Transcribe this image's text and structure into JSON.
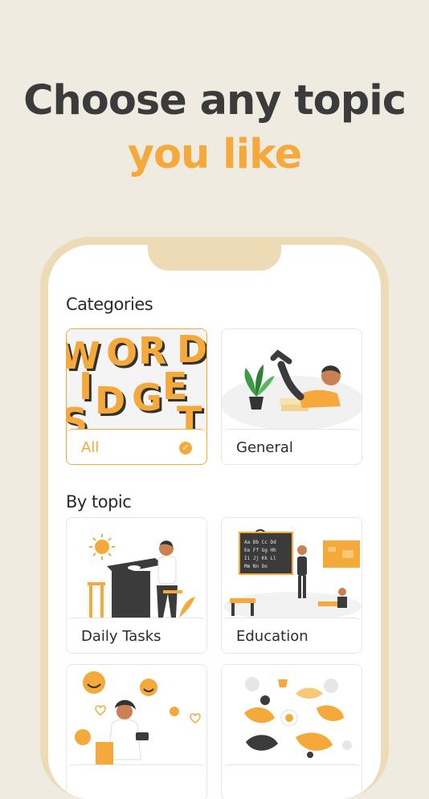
{
  "headline": {
    "line1": "Choose any topic",
    "line2": "you like"
  },
  "sections": {
    "categories": "Categories",
    "by_topic": "By topic"
  },
  "categories": [
    {
      "label": "All",
      "selected": true
    },
    {
      "label": "General",
      "selected": false
    }
  ],
  "topics": [
    {
      "label": "Daily Tasks"
    },
    {
      "label": "Education"
    },
    {
      "label": ""
    },
    {
      "label": ""
    }
  ],
  "colors": {
    "accent": "#f5a93a",
    "background": "#efebe1",
    "phone_frame": "#eddbb5",
    "text": "#3b3b3b"
  },
  "icons": {
    "selected_check": "check-circle-icon"
  }
}
